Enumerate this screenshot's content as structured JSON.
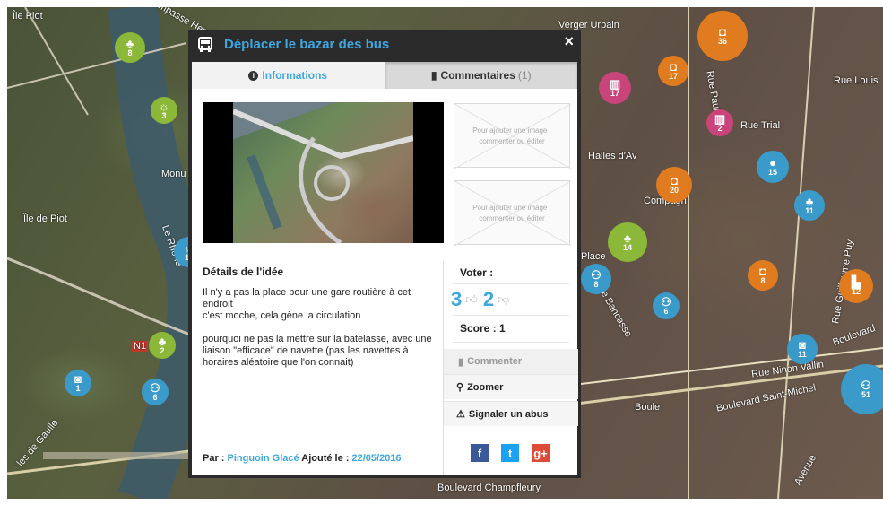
{
  "map": {
    "labels": [
      "Île Piot",
      "Impasse Henri",
      "Île de Piot",
      "Le Rhône",
      "Monu",
      "Verger Urbain",
      "Rue Louis",
      "Rue Trial",
      "Compagn",
      "Rue Guillaume Puy",
      "Place",
      "Boule",
      "Boulevard",
      "Rue Ninon Vallin",
      "Boulevard Saint-Michel",
      "Boulevard Champfleury",
      "Rue Bancasse",
      "Rue Paul Saïn",
      "N1",
      "Halles d'Av",
      "les de Gaulle",
      "Avenue"
    ],
    "markers": [
      {
        "color": "#8cb83a",
        "num": "8",
        "glyph": "tree"
      },
      {
        "color": "#8cb83a",
        "num": "3",
        "glyph": "run"
      },
      {
        "color": "#3a9ac9",
        "num": "12",
        "glyph": "run"
      },
      {
        "color": "#8cb83a",
        "num": "2",
        "glyph": "tree"
      },
      {
        "color": "#3a9ac9",
        "num": "1",
        "glyph": "car"
      },
      {
        "color": "#3a9ac9",
        "num": "6",
        "glyph": "bike"
      },
      {
        "color": "#e07b20",
        "num": "36",
        "glyph": "bag"
      },
      {
        "color": "#e07b20",
        "num": "17",
        "glyph": "bag"
      },
      {
        "color": "#c8447a",
        "num": "17",
        "glyph": "bank"
      },
      {
        "color": "#3a9ac9",
        "num": "15",
        "glyph": "pin"
      },
      {
        "color": "#e07b20",
        "num": "20",
        "glyph": "bag"
      },
      {
        "color": "#3a9ac9",
        "num": "11",
        "glyph": "tree"
      },
      {
        "color": "#8cb83a",
        "num": "14",
        "glyph": "tree"
      },
      {
        "color": "#e07b20",
        "num": "8",
        "glyph": "bag"
      },
      {
        "color": "#e07b20",
        "num": "12",
        "glyph": "factory"
      },
      {
        "color": "#3a9ac9",
        "num": "51",
        "glyph": "bike"
      },
      {
        "color": "#3a9ac9",
        "num": "11",
        "glyph": "car"
      },
      {
        "color": "#c8447a",
        "num": "2",
        "glyph": "bank"
      },
      {
        "color": "#3a9ac9",
        "num": "8",
        "glyph": "bike"
      },
      {
        "color": "#3a9ac9",
        "num": "6",
        "glyph": "bike"
      }
    ]
  },
  "modal": {
    "title": "Déplacer le bazar des bus",
    "close": "×",
    "tabs": {
      "info_label": "Informations",
      "comments_label": "Commentaires",
      "comments_count": "(1)"
    },
    "placeholder_text": "Pour ajouter une image : commenter ou éditer",
    "details": {
      "heading": "Détails de l'idée",
      "line1": "Il n'y a pas la place pour une gare routière à cet endroit",
      "line2": "c'est moche, cela gène la circulation",
      "line3": "pourquoi ne pas la mettre sur la batelasse, avec une liaison \"efficace\" de navette (pas les navettes à horaires aléatoire que l'on connait)"
    },
    "vote": {
      "label": "Voter :",
      "up_count": "3",
      "down_count": "2",
      "score_label": "Score : 1"
    },
    "actions": {
      "comment": "Commenter",
      "zoom": "Zoomer",
      "report": "Signaler un abus"
    },
    "share": {
      "facebook": "f",
      "twitter": "t",
      "google": "g+"
    },
    "footer": {
      "by_label": "Par :",
      "author": "Pinguoin Glacé",
      "added_label": "Ajouté le :",
      "date": "22/05/2016"
    }
  }
}
